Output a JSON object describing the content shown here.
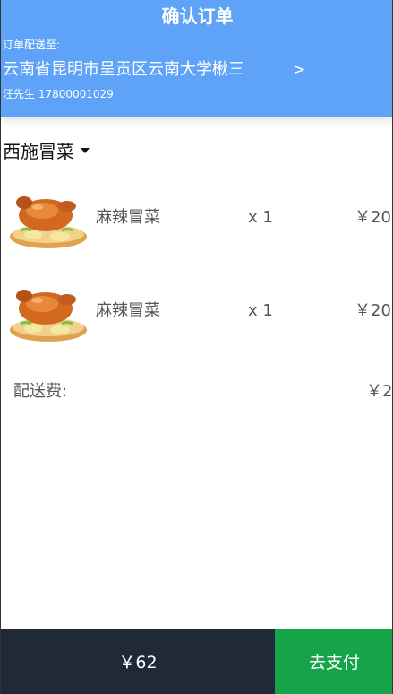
{
  "header": {
    "title": "确认订单",
    "deliver_to_label": "订单配送至:",
    "address": "云南省昆明市呈贡区云南大学楸三",
    "chevron": ">",
    "contact": "汪先生 17800001029"
  },
  "shop": {
    "name": "西施冒菜"
  },
  "items": [
    {
      "name": "麻辣冒菜",
      "qty": "x 1",
      "price": "￥20",
      "icon": "roast-chicken-image"
    },
    {
      "name": "麻辣冒菜",
      "qty": "x 1",
      "price": "￥20",
      "icon": "roast-chicken-image"
    }
  ],
  "delivery": {
    "label": "配送费:",
    "value": "￥2"
  },
  "footer": {
    "total": "￥62",
    "pay_label": "去支付"
  },
  "colors": {
    "header_bg": "#5ea3f7",
    "footer_total_bg": "#1f2937",
    "pay_button_bg": "#16a34a"
  }
}
